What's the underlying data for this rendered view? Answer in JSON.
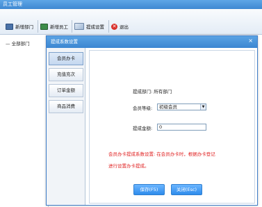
{
  "window": {
    "title": "员工管理"
  },
  "toolbar": {
    "add_department": "新增部门",
    "add_employee": "新增员工",
    "commission_settings": "提成设置",
    "exit": "退出",
    "exit_glyph": "✕"
  },
  "tree": {
    "root": "全部部门"
  },
  "dialog": {
    "title": "提成系数设置",
    "close": "×",
    "tabs": [
      "会员办卡",
      "充值充次",
      "订单金额",
      "商品消费"
    ],
    "active_tab": 0,
    "department_label": "提成部门: 所有部门",
    "level_label": "会员等级:",
    "level_value": "初级会员",
    "amount_label": "提成金额:",
    "amount_value": "0",
    "note_line1": "会员办卡提成系数设置: 在会员办卡时，根据办卡登记",
    "note_line2": "进行设置办卡提成。",
    "save_button": "保存(F5)",
    "close_button": "关闭(Esc)"
  },
  "colors": {
    "title_blue": "#3e88d2",
    "note_red": "#e02020",
    "button_blue": "#2e8cec"
  },
  "icons": [
    "department-icon",
    "employee-icon",
    "settings-icon",
    "exit-icon"
  ]
}
